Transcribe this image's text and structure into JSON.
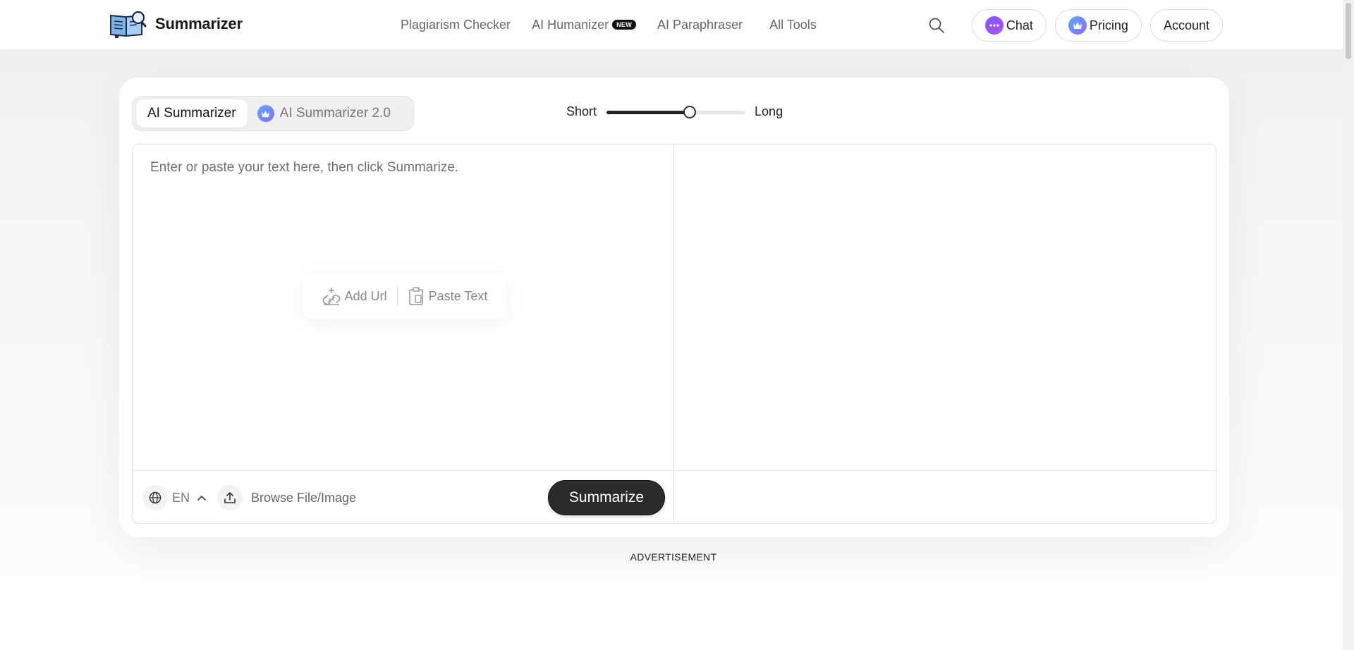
{
  "brand": {
    "name": "Summarizer"
  },
  "nav": {
    "items": [
      {
        "label": "Plagiarism Checker"
      },
      {
        "label": "AI Humanizer",
        "badge": "NEW"
      },
      {
        "label": "AI Paraphraser"
      },
      {
        "label": "All Tools"
      }
    ]
  },
  "header": {
    "chat_label": "Chat",
    "pricing_label": "Pricing",
    "account_label": "Account"
  },
  "tabs": [
    {
      "label": "AI Summarizer",
      "active": true
    },
    {
      "label": "AI Summarizer 2.0",
      "active": false
    }
  ],
  "length": {
    "short_label": "Short",
    "long_label": "Long",
    "value": 0.6
  },
  "editor": {
    "placeholder": "Enter or paste your text here, then click Summarize.",
    "add_url_label": "Add Url",
    "paste_text_label": "Paste Text",
    "language": "EN",
    "browse_label": "Browse File/Image",
    "summarize_label": "Summarize"
  },
  "ad_label": "ADVERTISEMENT",
  "colors": {
    "accent_dark": "#2b2b2b",
    "chat_icon": "#7b5cff",
    "crown_icon": "#5aa8ff"
  }
}
